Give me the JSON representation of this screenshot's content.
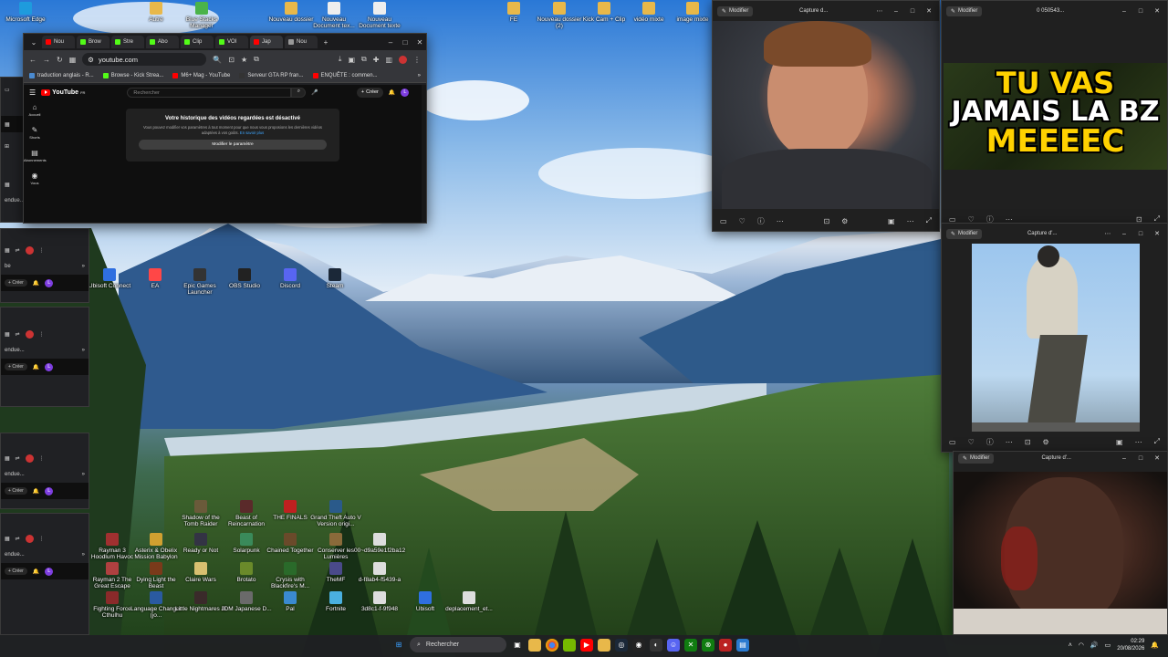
{
  "desktop": {
    "icons_top": [
      "Microsoft Edge",
      "Autre",
      "Blue Stacks Manager",
      "Nouveau dossier",
      "Nouveau Document tex...",
      "Nouveau Document texte",
      "FE",
      "Nouveau dossier (2)",
      "Kick Cam + Clip",
      "vidéo mixte",
      "image mixte"
    ],
    "icons_mid": [
      "Ubisoft Connect",
      "EA",
      "Epic Games Launcher",
      "OBS Studio",
      "Discord",
      "Steam"
    ],
    "icons_grid": [
      "Shadow of the Tomb Raider",
      "Beast of Reincarnation",
      "THE FINALS",
      "Grand Theft Auto V Version origi...",
      "Rayman 3 Hoodlum Havoc",
      "Asterix & Obelix Mission Babylon",
      "Ready or Not",
      "Solarpunk",
      "Chained Together",
      "Conserver les Lumières",
      "00~d9a59e1f2ba12",
      "Rayman 2 The Great Escape",
      "Dying Light the Beast",
      "Claire Wars",
      "Brotato",
      "Crysis with Blackfire's M...",
      "TheMF",
      "d-f8ab4-f5439-a",
      "Fighting Force Cthulhu",
      "Language Changer (jo...",
      "Little Nightmares III",
      "JDM Japanese D...",
      "Pal",
      "Fortnite",
      "3d8c1-f-9f948",
      "Ubisoft",
      "deplacement_et..."
    ]
  },
  "chrome": {
    "tabs": [
      "Nou",
      "Brow",
      "Stre",
      "Abo",
      "Clip",
      "VOI",
      "Jap",
      "Nou"
    ],
    "new_tab": "+",
    "url": "youtube.com",
    "bookmarks": [
      "traduction anglais - R...",
      "Browse - Kick Strea...",
      "M6+ Mag - YouTube",
      "Serveur GTA RP fran...",
      "ENQUÊTE : commen..."
    ],
    "bookmarks_more": "»",
    "youtube": {
      "brand": "YouTube",
      "brand_sup": "FR",
      "search_placeholder": "Rechercher",
      "create_label": "Créer",
      "avatar_letter": "L",
      "sidebar": [
        "Accueil",
        "Shorts",
        "Abonnements",
        "Vous"
      ],
      "history_title": "Votre historique des vidéos regardées est désactivé",
      "history_desc": "Vous pouvez modifier vos paramètres à tout moment pour que nous vous proposions les dernières vidéos adaptées à vos goûts.",
      "history_link": "En savoir plus",
      "history_button": "Modifier le paramètre"
    }
  },
  "players": [
    {
      "edit_label": "Modifier",
      "title": "Capture d..."
    },
    {
      "edit_label": "Modifier",
      "title": "0 050543...",
      "thumbnail_text": [
        "TU VAS",
        "JAMAIS LA BZ",
        "MEEEEC"
      ]
    },
    {
      "edit_label": "Modifier",
      "title": "Capture d'..."
    },
    {
      "edit_label": "Modifier",
      "title": "Capture d'..."
    }
  ],
  "bg_windows": {
    "label": "endue...",
    "label_alt": "be",
    "create_label": "Créer",
    "avatar_letter": "L"
  },
  "taskbar": {
    "search_placeholder": "Rechercher",
    "time": "02:29",
    "date": "20/08/2026"
  },
  "colors": {
    "youtube_red": "#ff0000",
    "kick_green": "#53fc18",
    "avatar_purple": "#7e3ee0",
    "link_blue": "#3ea6ff"
  }
}
